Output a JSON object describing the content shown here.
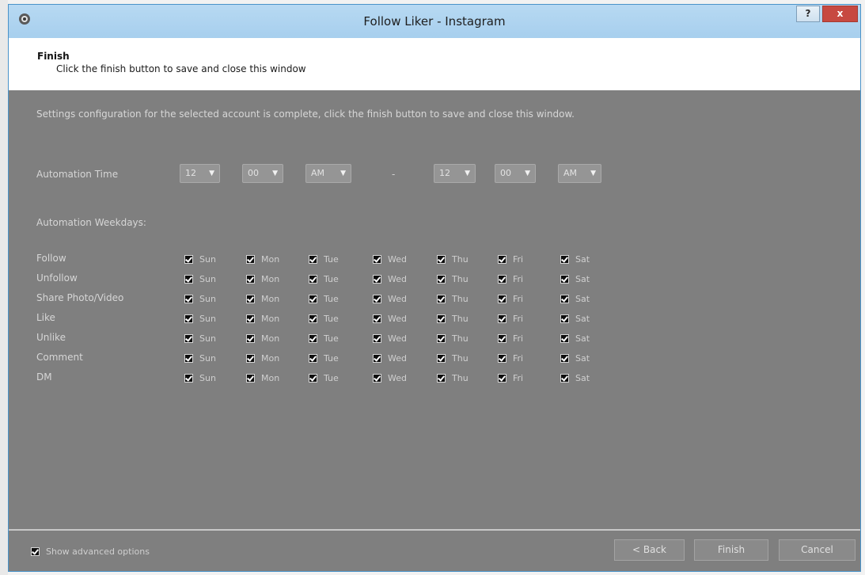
{
  "window": {
    "title": "Follow Liker - Instagram",
    "help_label": "?",
    "close_label": "x"
  },
  "header": {
    "title": "Finish",
    "subtitle": "Click the finish button to save and close this window"
  },
  "intro_text": "Settings configuration for the selected account is complete, click the finish button to save and close this window.",
  "automation_time": {
    "label": "Automation Time",
    "start": {
      "hour": "12",
      "minute": "00",
      "ampm": "AM"
    },
    "separator": "-",
    "end": {
      "hour": "12",
      "minute": "00",
      "ampm": "AM"
    }
  },
  "weekdays_label": "Automation Weekdays:",
  "day_labels": [
    "Sun",
    "Mon",
    "Tue",
    "Wed",
    "Thu",
    "Fri",
    "Sat"
  ],
  "rows": [
    {
      "label": "Follow",
      "checked": [
        true,
        true,
        true,
        true,
        true,
        true,
        true
      ]
    },
    {
      "label": "Unfollow",
      "checked": [
        true,
        true,
        true,
        true,
        true,
        true,
        true
      ]
    },
    {
      "label": "Share Photo/Video",
      "checked": [
        true,
        true,
        true,
        true,
        true,
        true,
        true
      ]
    },
    {
      "label": "Like",
      "checked": [
        true,
        true,
        true,
        true,
        true,
        true,
        true
      ]
    },
    {
      "label": "Unlike",
      "checked": [
        true,
        true,
        true,
        true,
        true,
        true,
        true
      ]
    },
    {
      "label": "Comment",
      "checked": [
        true,
        true,
        true,
        true,
        true,
        true,
        true
      ]
    },
    {
      "label": "DM",
      "checked": [
        true,
        true,
        true,
        true,
        true,
        true,
        true
      ]
    }
  ],
  "footer": {
    "advanced_label": "Show advanced options",
    "advanced_checked": true,
    "back_label": "< Back",
    "finish_label": "Finish",
    "cancel_label": "Cancel"
  }
}
